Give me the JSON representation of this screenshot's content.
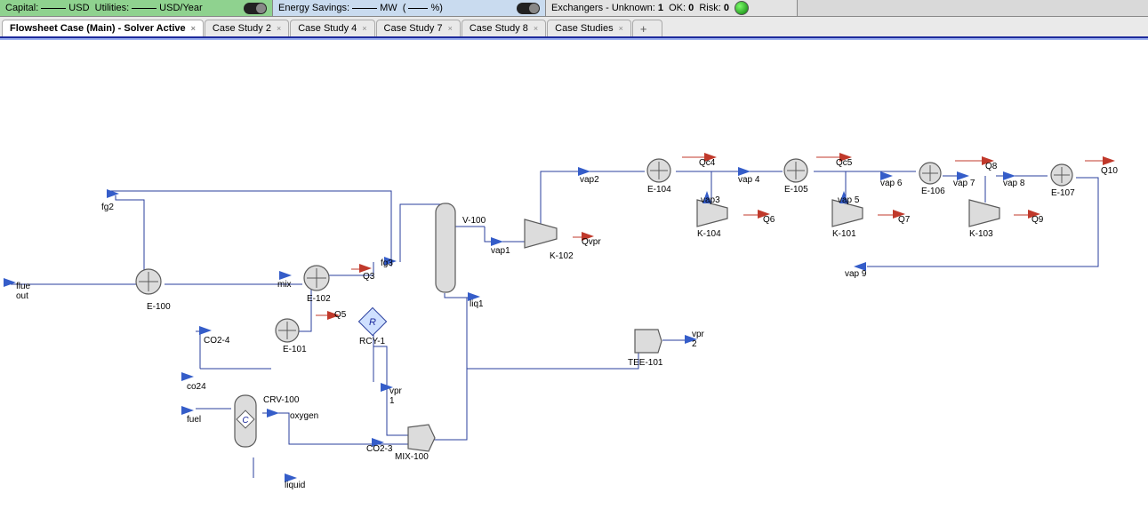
{
  "toolbar": {
    "capital_label": "Capital:",
    "capital_unit": "USD",
    "utilities_label": "Utilities:",
    "utilities_unit": "USD/Year",
    "energy_label": "Energy Savings:",
    "energy_unit": "MW",
    "pct_open": "(",
    "pct_close": "%)",
    "ex_label": "Exchangers - Unknown:",
    "ex_unknown": "1",
    "ex_ok_label": "OK:",
    "ex_ok": "0",
    "ex_risk_label": "Risk:",
    "ex_risk": "0"
  },
  "tabs": {
    "items": [
      {
        "label": "Flowsheet Case (Main) - Solver Active",
        "active": true
      },
      {
        "label": "Case Study 2"
      },
      {
        "label": "Case Study 4"
      },
      {
        "label": "Case Study 7"
      },
      {
        "label": "Case Study 8"
      },
      {
        "label": "Case Studies"
      }
    ],
    "add": "+"
  },
  "streams": {
    "flue_out": "flue\nout",
    "fg2": "fg2",
    "co2_4_upper": "CO2-4",
    "co24": "co24",
    "fuel": "fuel",
    "oxygen": "oxygen",
    "mix": "mix",
    "fg3": "fg3",
    "q3": "Q3",
    "q5": "Q5",
    "liquid": "liquid",
    "vpr1": "vpr\n1",
    "co2_3": "CO2-3",
    "liq1": "liq1",
    "vap1": "vap1",
    "qvpr": "Qvpr",
    "vap2": "vap2",
    "qc4": "Qc4",
    "vap_4": "vap 4",
    "vap3": "vap3",
    "q6": "Q6",
    "qc5": "Qc5",
    "vap5": "vap 5",
    "q7": "Q7",
    "vap6": "vap 6",
    "q8": "Q8",
    "vap7": "vap 7",
    "q9": "Q9",
    "vap8": "vap 8",
    "q10": "Q10",
    "vap9": "vap 9",
    "vpr2": "vpr\n2"
  },
  "units": {
    "e100": "E-100",
    "e101": "E-101",
    "e102": "E-102",
    "crv100": "CRV-100",
    "rcy1": "RCY-1",
    "mix100": "MIX-100",
    "v100": "V-100",
    "k102": "K-102",
    "tee101": "TEE-101",
    "e104": "E-104",
    "k104": "K-104",
    "e105": "E-105",
    "k101": "K-101",
    "e106": "E-106",
    "k103": "K-103",
    "e107": "E-107"
  },
  "recycle_badge": "R"
}
